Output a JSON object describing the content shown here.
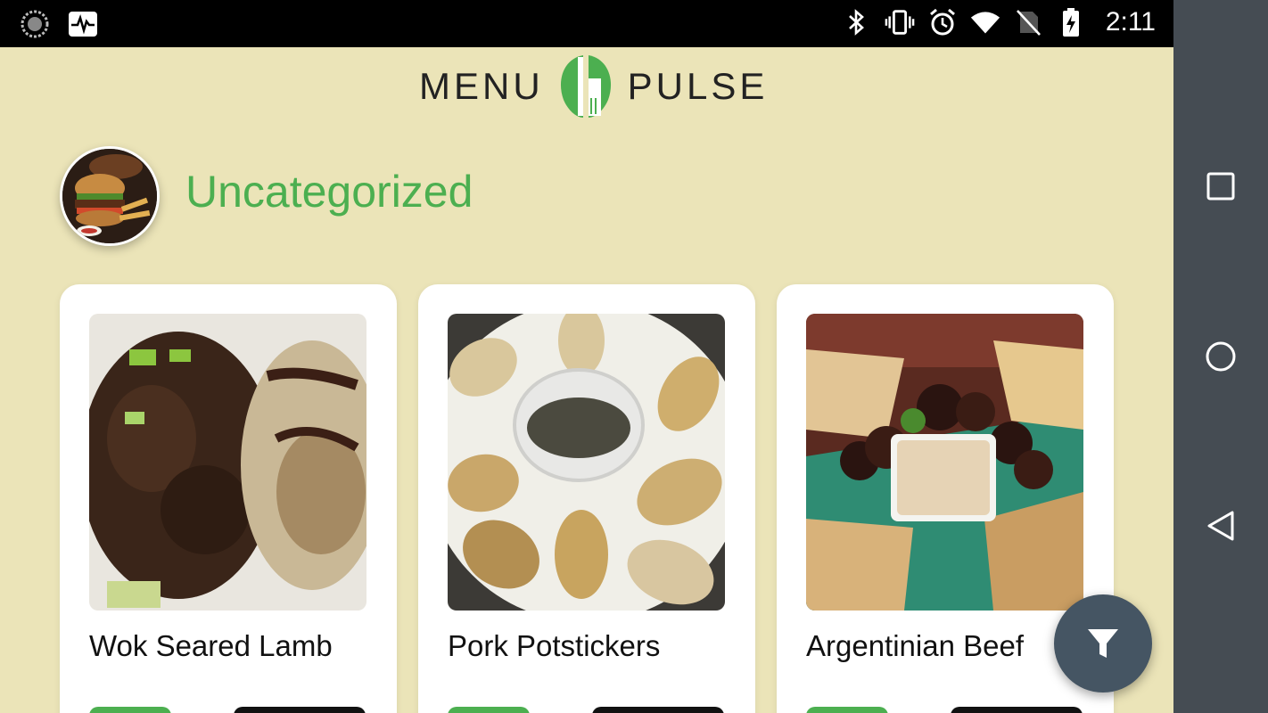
{
  "status_bar": {
    "time": "2:11",
    "left_icons": [
      "sync-icon",
      "activity-monitor-icon"
    ],
    "right_icons": [
      "bluetooth-icon",
      "vibrate-icon",
      "alarm-icon",
      "wifi-icon",
      "no-sim-icon",
      "battery-charging-icon"
    ]
  },
  "header": {
    "logo_left": "MENU",
    "logo_right": "PULSE"
  },
  "category": {
    "title": "Uncategorized"
  },
  "menu_items": [
    {
      "name": "Wok Seared Lamb"
    },
    {
      "name": "Pork Potstickers"
    },
    {
      "name": "Argentinian Beef"
    }
  ],
  "colors": {
    "background": "#ebe4b8",
    "accent_green": "#4caf50",
    "fab": "#455563",
    "nav_bar": "#454c53"
  },
  "fab": {
    "icon": "filter-icon"
  },
  "nav_bar": {
    "buttons": [
      "recents-icon",
      "home-icon",
      "back-icon"
    ]
  }
}
